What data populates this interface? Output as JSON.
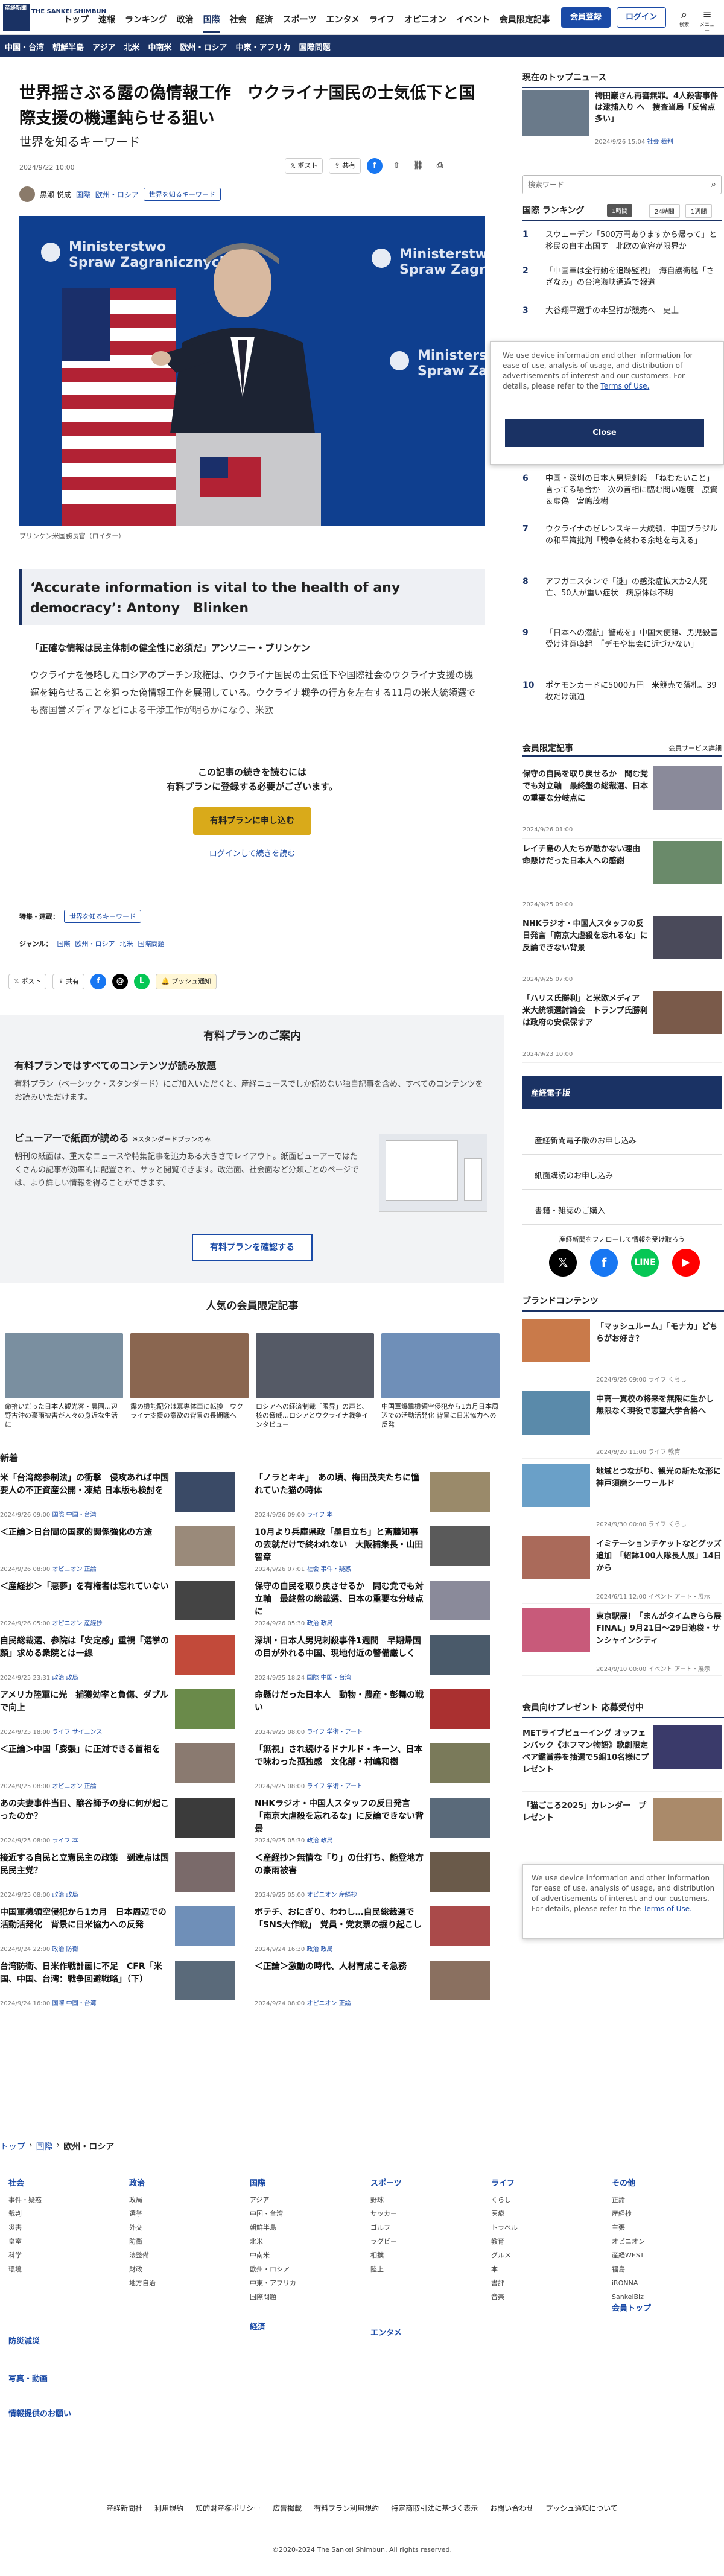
{
  "header": {
    "logo": "産経新聞",
    "logo_sub": "THE SANKEI SHIMBUN",
    "nav": [
      "トップ",
      "速報",
      "ランキング",
      "政治",
      "国際",
      "社会",
      "経済",
      "スポーツ",
      "エンタメ",
      "ライフ",
      "オピニオン",
      "イベント",
      "会員限定記事"
    ],
    "active_nav": "国際",
    "member_button": "会員登録",
    "login_button": "ログイン",
    "icons": [
      {
        "label": "検索"
      },
      {
        "label": "メニュー"
      }
    ]
  },
  "subnav": [
    "中国・台湾",
    "朝鮮半島",
    "アジア",
    "北米",
    "中南米",
    "欧州・ロシア",
    "中東・アフリカ",
    "国際問題"
  ],
  "article": {
    "title": "世界揺さぶる露の偽情報工作　ウクライナ国民の士気低下と国際支援の機運鈍らせる狙い",
    "subtitle": "世界を知るキーワード",
    "date": "2024/9/22 10:00",
    "author": "黒瀬 悦成",
    "tags": [
      "国際",
      "欧州・ロシア"
    ],
    "keyword_tag": "世界を知るキーワード",
    "share": {
      "post": "ポスト",
      "share": "共有"
    },
    "caption": "ブリンケン米国務長官（ロイター）",
    "pullquote": "‘Accurate information is vital to the health of any democracy’: Antony　Blinken",
    "lead": "「正確な情報は民主体制の健全性に必須だ」アンソニー・ブリンケン",
    "body": "ウクライナを侵略したロシアのプーチン政権は、ウクライナ国民の士気低下や国際社会のウクライナ支援の機運を鈍らせることを狙った偽情報工作を展開している。ウクライナ戦争の行方を左右する11月の米大統領選でも露国営メディアなどによる干渉工作が明らかになり、米欧",
    "paywall_line1": "この記事の続きを読むには",
    "paywall_line2": "有料プランに登録する必要がございます。",
    "plan_button": "有料プランに申し込む",
    "login_link": "ログインして続きを読む",
    "feature_label": "特集・連載：",
    "genre_label": "ジャンル：",
    "genre_tags": [
      "国際",
      "欧州・ロシア",
      "北米",
      "国際問題"
    ],
    "push_label": "プッシュ通知"
  },
  "plan_panel": {
    "title": "有料プランのご案内",
    "h1": "有料プランではすべてのコンテンツが読み放題",
    "p1": "有料プラン（ベーシック・スタンダード）にご加入いただくと、産経ニュースでしか読めない独自記事を含め、すべてのコンテンツをお読みいただけます。",
    "h2": "ビューアーで紙面が読める",
    "h2_note": "※スタンダードプランのみ",
    "p2": "朝刊の紙面は、重大なニュースや特集記事を追力ある大きさでレイアウト。紙面ビューアーではたくさんの記事が効率的に配置され、サッと閲覧できます。政治面、社会面など分類ごとのページでは、より詳しい情報を得ることができます。",
    "button": "有料プランを確認する"
  },
  "popular": {
    "heading": "人気の会員限定記事",
    "cards": [
      {
        "title": "命拾いだった日本人観光客・農園…辺野古沖の豪雨被害が人々の身近な生活に",
        "color": "#7a8fa0"
      },
      {
        "title": "露の機能配分は寡専体車に転換　ウクライナ支援の意欲の背景の長期戦へ",
        "color": "#8a6650"
      },
      {
        "title": "ロシアへの経済制裁「限界」の声と、核の脅威…ロシアとウクライナ戦争インタビュー",
        "color": "#555a66"
      },
      {
        "title": "中国軍爆撃機領空侵犯から1カ月日本周辺での活動活発化 背景に日米協力への反発",
        "color": "#6f8fb8"
      }
    ]
  },
  "new_label": "新着",
  "news_left": [
    {
      "title": "米「台湾総参制法」の衝撃　侵攻あれば中国要人の不正資産公開・凍結 日本版も検討を",
      "date": "2024/9/26 09:00",
      "cat": "国際",
      "sub": "中国・台湾",
      "color": "#3a4a66"
    },
    {
      "title": "＜正論＞日台間の国家的関係強化の方途",
      "date": "2024/9/26 08:00",
      "cat": "オピニオン",
      "sub": "正論",
      "color": "#9a8a7a"
    },
    {
      "title": "＜産経抄＞「悪夢」を有権者は忘れていない",
      "date": "2024/9/26 05:00",
      "cat": "オピニオン",
      "sub": "産経抄",
      "color": "#444"
    },
    {
      "title": "自民総裁選、参院は「安定感」重視「選挙の顔」求める衆院とは一線",
      "date": "2024/9/25 23:31",
      "cat": "政治",
      "sub": "政局",
      "color": "#c24a3a"
    },
    {
      "title": "アメリカ陸軍に光　捕獲効率と負傷、ダブルで向上",
      "date": "2024/9/25 18:00",
      "cat": "ライフ",
      "sub": "サイエンス",
      "color": "#6a8a4a"
    },
    {
      "title": "＜正論＞中国「膨張」に正対できる首相を",
      "date": "2024/9/25 08:00",
      "cat": "オピニオン",
      "sub": "正論",
      "color": "#8a7a70"
    },
    {
      "title": "あの夫妻事件当日、醸谷師予の身に何が起こったのか？",
      "date": "2024/9/25 08:00",
      "cat": "ライフ",
      "sub": "本",
      "color": "#3b3b3b"
    },
    {
      "title": "接近する自民と立憲民主の政策　到達点は国民民主党？",
      "date": "2024/9/25 08:00",
      "cat": "政治",
      "sub": "政局",
      "color": "#7a6a6a"
    },
    {
      "title": "中国軍機領空侵犯から1カ月　日本周辺での活動活発化　背景に日米協力への反発",
      "date": "2024/9/24 22:00",
      "cat": "政治",
      "sub": "防衛",
      "color": "#6f8fb8"
    },
    {
      "title": "台湾防衛、日米作戦計画に不足　CFR「米国、中国、台湾：戦争回避戦略」（下）",
      "date": "2024/9/24 16:00",
      "cat": "国際",
      "sub": "中国・台湾",
      "color": "#5a6a7a"
    }
  ],
  "news_right": [
    {
      "title": "「ノラとキキ」　あの頃、梅田茂夫たちに憧れていた猫の時体",
      "date": "2024/9/26 09:00",
      "cat": "ライフ",
      "sub": "本",
      "color": "#9a8a6a"
    },
    {
      "title": "10月より兵庫県政「墨目立ち」と斎藤知事の去就だけで終われない　大阪補集長・山田智章",
      "date": "2024/9/26 07:01",
      "cat": "社会",
      "sub": "事件・疑惑",
      "color": "#5a5a5a"
    },
    {
      "title": "保守の自民を取り戻させるか　問む党でも対立軸　最終盤の総裁選、日本の重要な分岐点に",
      "date": "2024/9/26 05:30",
      "cat": "政治",
      "sub": "政局",
      "color": "#8a8a9a"
    },
    {
      "title": "深圳・日本人男児刺殺事件1週間　早期帰国の目が外れる中国、現地付近の警備厳しく",
      "date": "2024/9/25 18:24",
      "cat": "国際",
      "sub": "中国・台湾",
      "color": "#4a5a6a"
    },
    {
      "title": "命懸けだった日本人　動物・農産・彭舞の戦い",
      "date": "2024/9/25 08:00",
      "cat": "ライフ",
      "sub": "学術・アート",
      "color": "#aa3030"
    },
    {
      "title": "「無視」され続けるドナルド・キーン、日本で味わった孤独感　文化部・村嶋和樹",
      "date": "2024/9/25 08:00",
      "cat": "ライフ",
      "sub": "学術・アート",
      "color": "#7a7a5a"
    },
    {
      "title": "NHKラジオ・中国人スタッフの反日発言「南京大虐殺を忘れるな」に反論できない背景",
      "date": "2024/9/25 05:30",
      "cat": "政治",
      "sub": "政局",
      "color": "#5a6a7a"
    },
    {
      "title": "＜産経抄＞無情な「り」の仕打ち、能登地方の豪雨被害",
      "date": "2024/9/25 05:00",
      "cat": "オピニオン",
      "sub": "産経抄",
      "color": "#6a5a4a"
    },
    {
      "title": "ボテチ、おにぎり、わわし…自民総裁選で「SNS大作戦」　党員・党友票の掘り起こし",
      "date": "2024/9/24 16:30",
      "cat": "政治",
      "sub": "政局",
      "color": "#aa4a4a"
    },
    {
      "title": "＜正論＞激動の時代、人材育成こそ急務",
      "date": "2024/9/24 08:00",
      "cat": "オピニオン",
      "sub": "正論",
      "color": "#8a7060"
    }
  ],
  "sidebar": {
    "top_news_h": "現在のトップニュース",
    "top_news": {
      "title": "袴田巖さん再審無罪。4人殺害事件は逮捕入り へ　捜査当局「反省点多い」",
      "date": "2024/9/26 15:04",
      "cat": "社会",
      "sub": "裁判"
    },
    "search_placeholder": "検索ワード",
    "ranking_h": "国際 ランキング",
    "ranking_tabs": [
      "1時間",
      "24時間",
      "1週間"
    ],
    "ranking": [
      "スウェーデン「500万円ありますから帰って」と移民の自主出国す　北欧の寛容が限界か",
      "「中国軍は全行動を追跡監視」　海自護衛艦「さざなみ」の台湾海峡通過で報道",
      "大谷翔平選手の本塁打が競売へ　史上",
      "",
      "",
      "中国・深圳の日本人男児刺殺　「ねむたいこと」言ってる場合か　次の首相に臨む問い題度　原資＆虚偽　宮嶋茂樹",
      "ウクライナのゼレンスキー大統領、中国ブラジルの和平策批判「戦争を終わる余地を与える」",
      "アフガニスタンで「謎」の感染症拡大か2人死亡、50人が重い症状　病原体は不明",
      "「日本への潜航」警戒を」中国大使館、男児殺害受け注意喚起　「デモや集会に近づかない」",
      "ポケモンカードに5000万円　米競売で落札。39枚だけ流通"
    ],
    "consent_text": "We use device information and other information for ease of use, analysis of usage, and distribution of advertisements of interest and our customers. For details, please refer to the ",
    "consent_link": "Terms of Use.",
    "consent_close": "Close",
    "member_h": "会員限定記事",
    "member_more": "会員サービス詳細",
    "member_items": [
      {
        "title": "保守の自民を取り戻せるか　問む党でも対立軸　最終盤の総裁選、日本の重要な分岐点に",
        "date": "2024/9/26 01:00",
        "color": "#8a8a9a"
      },
      {
        "title": "レイチ島の人たちが敵かない理由　命懸けだった日本人への感謝",
        "date": "2024/9/25 09:00",
        "color": "#6a8a6a"
      },
      {
        "title": "NHKラジオ・中国人スタッフの反日発言「南京大虐殺を忘れるな」に反論できない背景",
        "date": "2024/9/25 07:00",
        "color": "#4a4a5a"
      },
      {
        "title": "「ハリス氏勝利」と米欧メディア　米大統領選討論会　トランプ氏勝利は政府の安保保すア",
        "date": "2024/9/23 10:00",
        "color": "#7a5a4a"
      }
    ],
    "sankei_banner": "産経電子版",
    "links": [
      "産経新聞電子版のお申し込み",
      "紙面購読のお申し込み",
      "書籍・雑誌のご購入"
    ],
    "follow_text": "産経新聞をフォローして情報を受け取ろう",
    "social": [
      {
        "name": "x",
        "color": "#000"
      },
      {
        "name": "facebook",
        "color": "#1877f2"
      },
      {
        "name": "line",
        "color": "#06c755"
      },
      {
        "name": "youtube",
        "color": "#ff0000"
      }
    ],
    "brand_h": "ブランドコンテンツ",
    "brand_items": [
      {
        "title": "「マッシュルーム」「モナカ」どちらがお好き？",
        "date": "2024/9/26 09:00",
        "cat": "ライフ",
        "sub": "くらし",
        "color": "#c97a4a"
      },
      {
        "title": "中高一貫校の将来を無限に生かし　無限なく現役で志望大学合格へ",
        "date": "2024/9/20 11:00",
        "cat": "ライフ",
        "sub": "教育",
        "color": "#5a8aaa"
      },
      {
        "title": "地域とつながり、観光の新たな形に　神戸須磨シーワールド",
        "date": "2024/9/30 00:00",
        "cat": "ライフ",
        "sub": "くらし",
        "color": "#6aa0c8"
      },
      {
        "title": "イミテーションチケットなどグッズ追加　「紹鉢100人隊長人展」14日から",
        "date": "2024/6/11 12:00",
        "cat": "イベント",
        "sub": "アート・展示",
        "color": "#aa6a5a"
      },
      {
        "title": "東京駅展！「まんがタイムきらら展FINAL」9月21日〜29日池袋・サンシャインシティ",
        "date": "2024/9/10 00:00",
        "cat": "イベント",
        "sub": "アート・展示",
        "color": "#c85a7a"
      }
    ],
    "present_h": "会員向けプレゼント 応募受付中",
    "present_items": [
      {
        "title": "METライブビューイング オッフェンバック《ホフマン物語》歌劇限定 ペア鑑賞券を抽選で5組10名様にプレゼント",
        "color": "#3a3a6a"
      },
      {
        "title": "「猫ごころ2025」カレンダー　プレゼント",
        "color": "#aa8a6a"
      }
    ]
  },
  "footer": {
    "breadcrumb": [
      "トップ",
      "国際",
      "欧州・ロシア"
    ],
    "cols": [
      {
        "h": "社会",
        "items": [
          "事件・疑惑",
          "裁判",
          "災害",
          "皇室",
          "科学",
          "環境"
        ]
      },
      {
        "h": "政治",
        "items": [
          "政局",
          "選挙",
          "外交",
          "防衛",
          "法整備",
          "財政",
          "地方自治"
        ]
      },
      {
        "h": "国際",
        "items": [
          "アジア",
          "中国・台湾",
          "朝鮮半島",
          "北米",
          "中南米",
          "欧州・ロシア",
          "中東・アフリカ",
          "国際問題"
        ]
      },
      {
        "h": "スポーツ",
        "items": [
          "野球",
          "サッカー",
          "ゴルフ",
          "ラグビー",
          "相撲",
          "陸上"
        ]
      },
      {
        "h": "ライフ",
        "items": [
          "くらし",
          "医療",
          "トラベル",
          "教育",
          "グルメ",
          "本",
          "書評",
          "音楽"
        ]
      },
      {
        "h": "その他",
        "items": [
          "正論",
          "産経抄",
          "主張",
          "オピニオン",
          "産経WEST",
          "福島",
          "iRONNA",
          "SankeiBiz"
        ]
      }
    ],
    "extra_h": [
      "防災減災",
      "写真・動画",
      "情報提供のお願い",
      "経済",
      "エンタメ",
      "会員トップ"
    ],
    "bar": [
      "産経新聞社",
      "利用規約",
      "知的財産権ポリシー",
      "広告掲載",
      "有料プラン利用規約",
      "特定商取引法に基づく表示",
      "お問い合わせ",
      "プッシュ通知について"
    ],
    "copyright": "©2020-2024 The Sankei Shimbun. All rights reserved."
  }
}
